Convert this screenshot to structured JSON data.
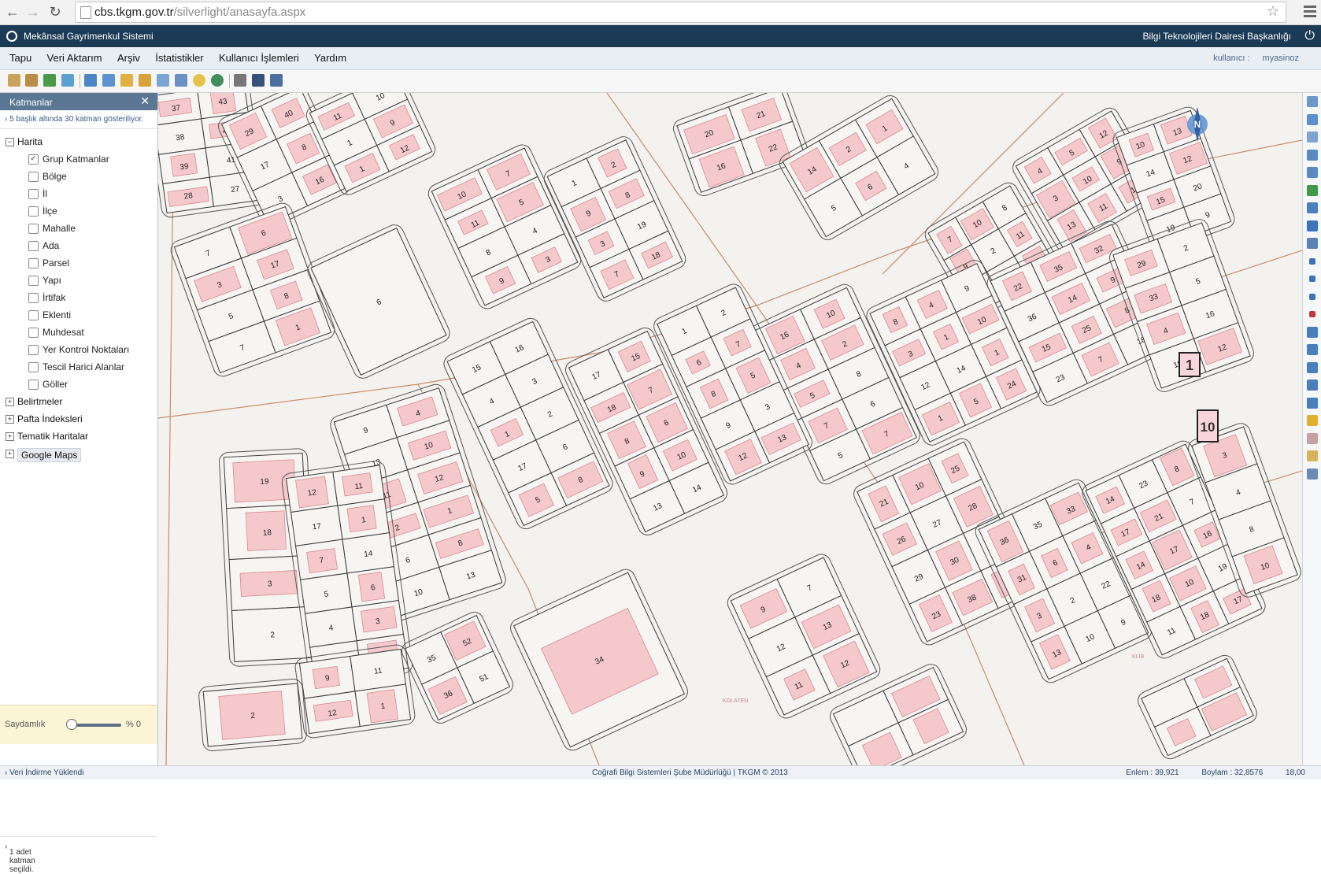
{
  "browser": {
    "url_host": "cbs.tkgm.gov.tr",
    "url_path": "/silverlight/anasayfa.aspx"
  },
  "app": {
    "title": "Mekânsal Gayrimenkul Sistemi",
    "department": "Bilgi Teknolojileri Dairesi Başkanlığı"
  },
  "menu": {
    "items": [
      "Tapu",
      "Veri Aktarım",
      "Arşiv",
      "İstatistikler",
      "Kullanıcı İşlemleri",
      "Yardım"
    ]
  },
  "user": {
    "label": "kullanıcı :",
    "name": "myasinoz"
  },
  "layers_panel": {
    "title": "Katmanlar",
    "info": "5 başlık altında 30 katman gösteriliyor.",
    "root_harita": "Harita",
    "harita_children": [
      "Grup Katmanlar",
      "Bölge",
      "İl",
      "İlçe",
      "Mahalle",
      "Ada",
      "Parsel",
      "Yapı",
      "İrtifak",
      "Eklenti",
      "Muhdesat",
      "Yer Kontrol Noktaları",
      "Tescil Harici Alanlar",
      "Göller"
    ],
    "checked_index": 0,
    "other_roots": [
      "Belirtmeler",
      "Pafta İndeksleri",
      "Tematik Haritalar",
      "Google Maps"
    ],
    "transparency_label": "Saydamlık",
    "transparency_value": "% 0",
    "transparency_fraction": 0,
    "selected_text": "1 adet katman seçildi."
  },
  "map": {
    "parcel_labels": [
      "37",
      "43",
      "38",
      "42",
      "39",
      "41",
      "28",
      "27",
      "29",
      "40",
      "17",
      "8",
      "3",
      "16",
      "11",
      "10",
      "1",
      "9",
      "1",
      "12",
      "7",
      "6",
      "3",
      "17",
      "5",
      "8",
      "7",
      "1",
      "6",
      "10",
      "7",
      "11",
      "5",
      "8",
      "4",
      "9",
      "3",
      "1",
      "2",
      "9",
      "8",
      "3",
      "19",
      "7",
      "18",
      "20",
      "21",
      "16",
      "22",
      "14",
      "2",
      "1",
      "5",
      "6",
      "4",
      "7",
      "10",
      "8",
      "9",
      "2",
      "11",
      "7",
      "13",
      "14",
      "4",
      "5",
      "12",
      "3",
      "10",
      "9",
      "13",
      "11",
      "14",
      "10",
      "13",
      "14",
      "12",
      "15",
      "20",
      "19",
      "9",
      "16",
      "10",
      "4",
      "2",
      "5",
      "8",
      "7",
      "6",
      "5",
      "7",
      "8",
      "4",
      "9",
      "3",
      "1",
      "10",
      "12",
      "14",
      "1",
      "1",
      "5",
      "24",
      "22",
      "35",
      "32",
      "36",
      "14",
      "9",
      "15",
      "25",
      "8",
      "23",
      "7",
      "18",
      "29",
      "2",
      "33",
      "5",
      "4",
      "16",
      "19",
      "12",
      "1",
      "2",
      "6",
      "7",
      "8",
      "5",
      "9",
      "3",
      "12",
      "13",
      "17",
      "15",
      "18",
      "7",
      "8",
      "6",
      "9",
      "10",
      "13",
      "14",
      "15",
      "16",
      "4",
      "3",
      "1",
      "2",
      "17",
      "6",
      "5",
      "8",
      "9",
      "4",
      "13",
      "10",
      "11",
      "12",
      "2",
      "1",
      "6",
      "8",
      "10",
      "13",
      "19",
      "18",
      "3",
      "2",
      "12",
      "11",
      "17",
      "1",
      "7",
      "14",
      "5",
      "6",
      "4",
      "3",
      "15",
      "16",
      "21",
      "10",
      "25",
      "26",
      "27",
      "28",
      "29",
      "30",
      "32",
      "23",
      "38",
      "37",
      "36",
      "35",
      "33",
      "31",
      "6",
      "4",
      "3",
      "2",
      "22",
      "13",
      "10",
      "9",
      "14",
      "23",
      "8",
      "17",
      "21",
      "7",
      "14",
      "17",
      "16",
      "18",
      "10",
      "19",
      "11",
      "18",
      "17",
      "9",
      "7",
      "12",
      "13",
      "11",
      "12",
      "34",
      "35",
      "52",
      "36",
      "51",
      "9",
      "11",
      "12",
      "1",
      "2",
      "3",
      "4",
      "8",
      "10"
    ],
    "large_labels": [
      "1",
      "10"
    ],
    "compass_label": "N",
    "watermark_1": "KOLATEN",
    "watermark_2": "KLİB"
  },
  "status": {
    "left": "Veri İndirme Yüklendi",
    "center": "Coğrafi Bilgi Sistemleri Şube Müdürlüğü | TKGM © 2013",
    "lat_label": "Enlem : 39,921",
    "lon_label": "Boylam : 32,8576",
    "zoom": "18,00"
  }
}
